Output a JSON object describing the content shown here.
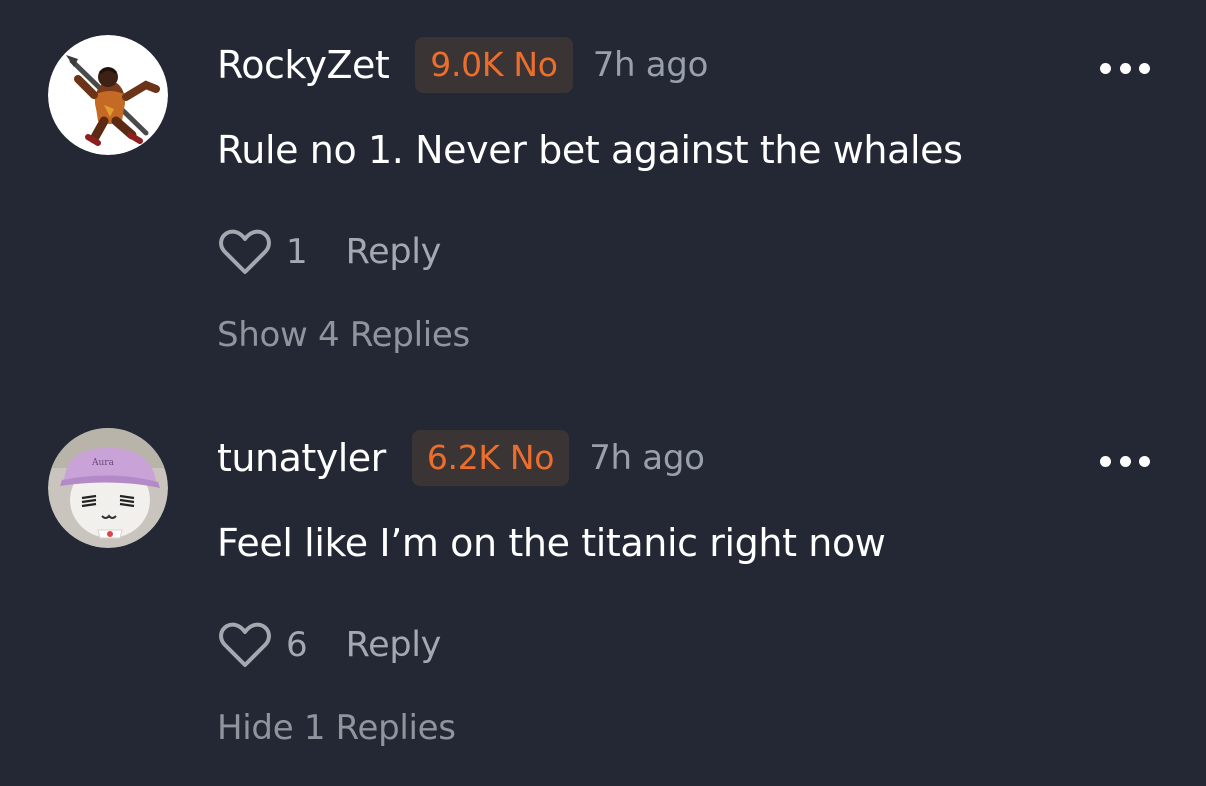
{
  "comments": [
    {
      "username": "RockyZet",
      "badge": "9.0K No",
      "time": "7h ago",
      "text": "Rule no 1. Never bet against the whales",
      "likes": "1",
      "reply_label": "Reply",
      "replies_toggle": "Show 4 Replies",
      "avatar": "warrior-character-icon"
    },
    {
      "username": "tunatyler",
      "badge": "6.2K No",
      "time": "7h ago",
      "text": "Feel like I’m on the titanic right now",
      "likes": "6",
      "reply_label": "Reply",
      "replies_toggle": "Hide 1 Replies",
      "avatar": "plush-toy-with-cap-icon",
      "avatar_cap_text": "Aura"
    }
  ],
  "colors": {
    "background": "#232834",
    "badge_text": "#ec6e2d",
    "badge_bg": "#3a3434",
    "muted_text": "#a4a8b0"
  }
}
